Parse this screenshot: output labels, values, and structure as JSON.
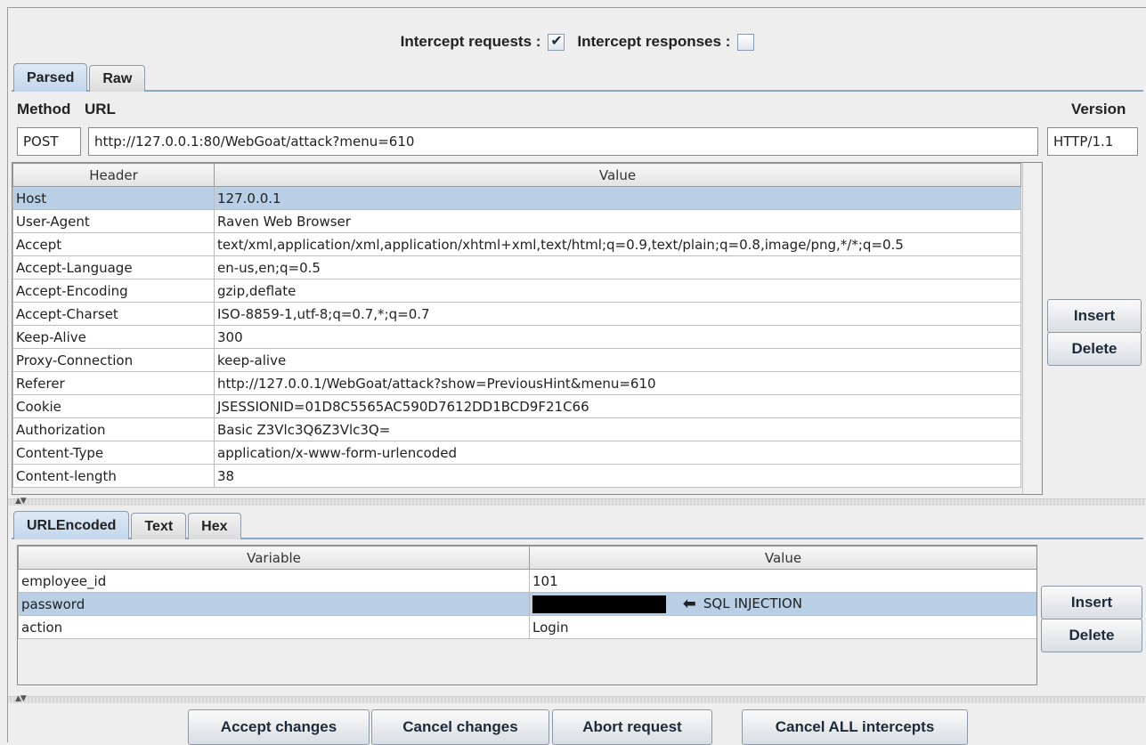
{
  "intercept": {
    "requests_label": "Intercept requests :",
    "requests_checked": true,
    "responses_label": "Intercept responses :",
    "responses_checked": false
  },
  "top_tabs": [
    "Parsed",
    "Raw"
  ],
  "request_line": {
    "method_label": "Method",
    "url_label": "URL",
    "version_label": "Version",
    "method": "POST",
    "url": "http://127.0.0.1:80/WebGoat/attack?menu=610",
    "version": "HTTP/1.1"
  },
  "headers_table": {
    "columns": [
      "Header",
      "Value"
    ],
    "rows": [
      {
        "name": "Host",
        "value": "127.0.0.1"
      },
      {
        "name": "User-Agent",
        "value": "Raven Web Browser"
      },
      {
        "name": "Accept",
        "value": "text/xml,application/xml,application/xhtml+xml,text/html;q=0.9,text/plain;q=0.8,image/png,*/*;q=0.5"
      },
      {
        "name": "Accept-Language",
        "value": "en-us,en;q=0.5"
      },
      {
        "name": "Accept-Encoding",
        "value": "gzip,deflate"
      },
      {
        "name": "Accept-Charset",
        "value": "ISO-8859-1,utf-8;q=0.7,*;q=0.7"
      },
      {
        "name": "Keep-Alive",
        "value": "300"
      },
      {
        "name": "Proxy-Connection",
        "value": "keep-alive"
      },
      {
        "name": "Referer",
        "value": "http://127.0.0.1/WebGoat/attack?show=PreviousHint&menu=610"
      },
      {
        "name": "Cookie",
        "value": "JSESSIONID=01D8C5565AC590D7612DD1BCD9F21C66"
      },
      {
        "name": "Authorization",
        "value": "Basic Z3Vlc3Q6Z3Vlc3Q="
      },
      {
        "name": "Content-Type",
        "value": "application/x-www-form-urlencoded"
      },
      {
        "name": "Content-length",
        "value": "38"
      }
    ],
    "selected_row": 0
  },
  "headers_buttons": {
    "insert": "Insert",
    "delete": "Delete"
  },
  "body_tabs": [
    "URLEncoded",
    "Text",
    "Hex"
  ],
  "body_table": {
    "columns": [
      "Variable",
      "Value"
    ],
    "rows": [
      {
        "name": "employee_id",
        "value": "101"
      },
      {
        "name": "password",
        "value": ""
      },
      {
        "name": "action",
        "value": "Login"
      }
    ],
    "selected_row": 1,
    "annotation": "SQL INJECTION"
  },
  "body_buttons": {
    "insert": "Insert",
    "delete": "Delete"
  },
  "footer_buttons": {
    "accept": "Accept changes",
    "cancel": "Cancel changes",
    "abort": "Abort request",
    "cancel_all": "Cancel ALL intercepts"
  }
}
